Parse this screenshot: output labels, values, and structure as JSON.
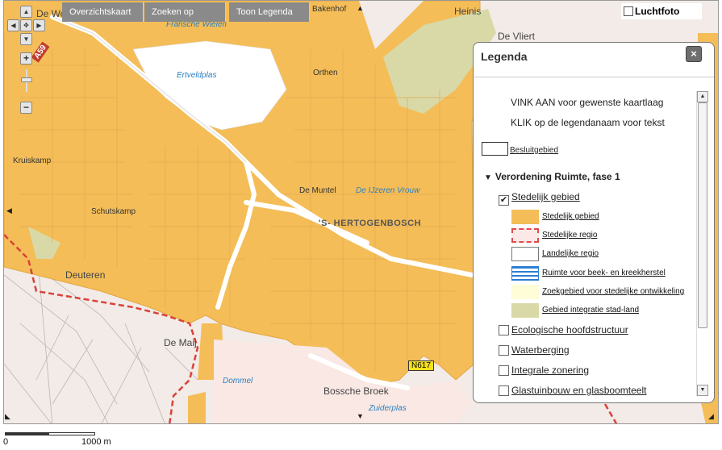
{
  "toolbar": {
    "overview": "Overzichtskaart",
    "search": "Zoeken op",
    "legend": "Toon Legenda",
    "aerial": "Luchtfoto"
  },
  "map": {
    "places": [
      {
        "name": "De Wo",
        "kind": "lg"
      },
      {
        "name": "Fransche Wielen",
        "kind": "water"
      },
      {
        "name": "Bakenhof",
        "kind": "normal"
      },
      {
        "name": "Heinis",
        "kind": "lg"
      },
      {
        "name": "De Vliert",
        "kind": "lg"
      },
      {
        "name": "Ertveldplas",
        "kind": "water"
      },
      {
        "name": "Orthen",
        "kind": "normal"
      },
      {
        "name": "Kruiskamp",
        "kind": "normal"
      },
      {
        "name": "De Muntel",
        "kind": "normal"
      },
      {
        "name": "De IJzeren Vrouw",
        "kind": "water"
      },
      {
        "name": "'S- HERTOGENBOSCH",
        "kind": "big"
      },
      {
        "name": "Schutskamp",
        "kind": "normal"
      },
      {
        "name": "Deuteren",
        "kind": "lg"
      },
      {
        "name": "De Maij",
        "kind": "lg"
      },
      {
        "name": "Dommel",
        "kind": "water"
      },
      {
        "name": "Bossche Broek",
        "kind": "lg"
      },
      {
        "name": "Zuiderplas",
        "kind": "water"
      }
    ],
    "road_label": "A59",
    "road_label2": "N617"
  },
  "legend": {
    "title": "Legenda",
    "close": "×",
    "instructions": [
      "VINK AAN voor gewenste kaartlaag",
      "KLIK op de legendanaam voor tekst"
    ],
    "besluitgebied": "Besluitgebied",
    "group": "Verordening Ruimte, fase 1",
    "checked_layer": "Stedelijk gebied",
    "swatches": [
      {
        "label": "Stedelijk gebied",
        "color": "#f4bd58"
      },
      {
        "label": "Stedelijke regio",
        "color": "#fde8e8"
      },
      {
        "label": "Landelijke regio",
        "color": "#ffffff"
      },
      {
        "label": "Ruimte voor beek- en kreekherstel",
        "color": "#2d7ed4"
      },
      {
        "label": "Zoekgebied voor stedelijke ontwikkeling",
        "color": "#fffcd8"
      },
      {
        "label": "Gebied integratie stad-land",
        "color": "#d9d9a8"
      }
    ],
    "layers": [
      "Ecologische hoofdstructuur",
      "Waterberging",
      "Integrale zonering",
      "Glastuinbouw en glasboomteelt"
    ]
  },
  "scale": {
    "start": "0",
    "end": "1000 m"
  },
  "colors": {
    "urban": "#f4bd58",
    "urban_line": "#e3a640",
    "rural": "#f2ebe7",
    "water": "#ffffff",
    "integration": "#d9d9a8"
  }
}
